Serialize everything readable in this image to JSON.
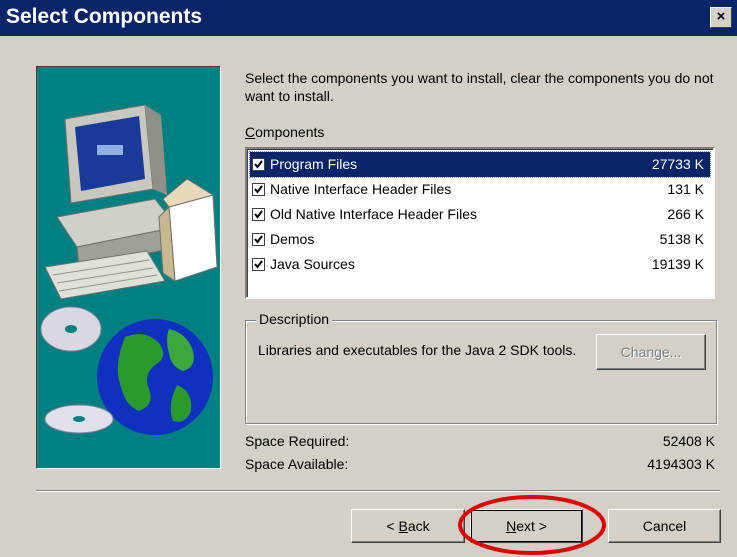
{
  "window": {
    "title": "Select Components",
    "close_label": "×"
  },
  "intro_text": "Select the components you want to install, clear the components you do not want to install.",
  "components_label_first": "C",
  "components_label_rest": "omponents",
  "components": [
    {
      "label": "Program Files",
      "size": "27733 K",
      "checked": true,
      "selected": true
    },
    {
      "label": "Native Interface Header Files",
      "size": "131 K",
      "checked": true,
      "selected": false
    },
    {
      "label": "Old Native  Interface Header Files",
      "size": "266 K",
      "checked": true,
      "selected": false
    },
    {
      "label": "Demos",
      "size": "5138 K",
      "checked": true,
      "selected": false
    },
    {
      "label": "Java Sources",
      "size": "19139 K",
      "checked": true,
      "selected": false
    }
  ],
  "description": {
    "title": "Description",
    "text": "Libraries and executables for the Java 2 SDK tools.",
    "change_button": "Change..."
  },
  "space": {
    "required_label": "Space Required:",
    "required_value": "52408 K",
    "available_label": "Space Available:",
    "available_value": "4194303 K"
  },
  "buttons": {
    "back_prefix": "< ",
    "back_mnemonic": "B",
    "back_rest": "ack",
    "next_mnemonic": "N",
    "next_rest": "ext >",
    "cancel": "Cancel"
  },
  "colors": {
    "title_bar": "#0a246a",
    "dialog_bg": "#d4d0c8",
    "art_bg": "#008080",
    "annotation": "#e00000"
  }
}
